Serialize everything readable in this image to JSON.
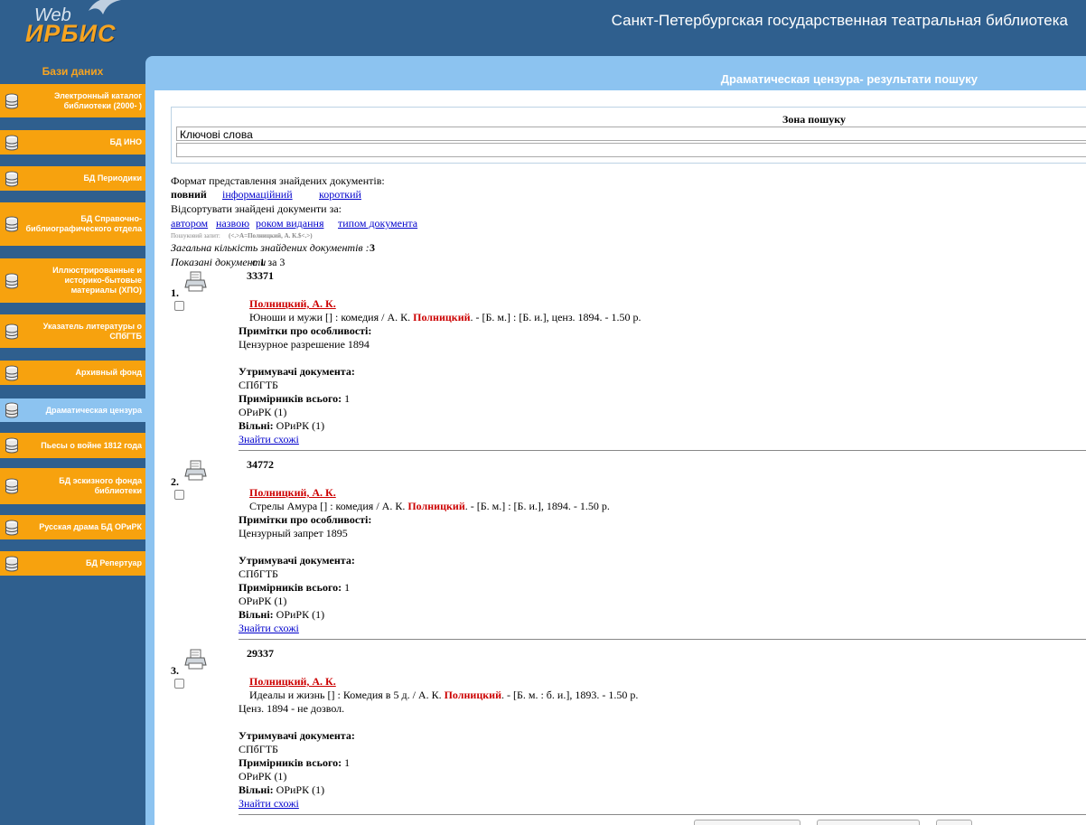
{
  "header": {
    "logo_web": "Web",
    "logo_irbis": "ИРБИС",
    "site_title": "Санкт-Петербургская государственная театральная библиотека"
  },
  "sidebar": {
    "title": "Бази даних",
    "items": [
      {
        "label": "Электронный каталог библиотеки (2000- )",
        "active": false
      },
      {
        "label": "БД ИНО",
        "active": false
      },
      {
        "label": "БД Периодики",
        "active": false
      },
      {
        "label": "БД Справочно-библиографического отдела",
        "active": false
      },
      {
        "label": "Иллюстрированные и историко-бытовые материалы (ХПО)",
        "active": false
      },
      {
        "label": "Указатель литературы о СПбГТБ",
        "active": false
      },
      {
        "label": "Архивный фонд",
        "active": false
      },
      {
        "label": "Драматическая цензура",
        "active": true
      },
      {
        "label": "Пьесы о войне 1812 года",
        "active": false
      },
      {
        "label": "БД эскизного фонда библиотеки",
        "active": false
      },
      {
        "label": "Русская драма БД ОРиРК",
        "active": false
      },
      {
        "label": "БД Репертуар",
        "active": false
      }
    ]
  },
  "panel": {
    "title": "Драматическая цензура- результати пошуку"
  },
  "search": {
    "zone_label": "Зона пошуку",
    "field_value": "Ключові слова",
    "query_value": ""
  },
  "format": {
    "label": "Формат представлення знайдених документів:",
    "full": "повний",
    "info": "інформаційний",
    "short": "короткий"
  },
  "sort": {
    "label": "Відсортувати знайдені документи за:",
    "by_author": "автором",
    "by_title": "назвою",
    "by_year": "роком видання",
    "by_type": "типом документа"
  },
  "query_line": {
    "label": "Пошуковий запит:",
    "value": "(<.>A=Полницкий, А. К.$<.>)"
  },
  "total": {
    "label": "Загальна кількість знайдених документів :",
    "count": "3"
  },
  "shown": {
    "label": "Показані документи",
    "range": "с 1 за 3"
  },
  "labels": {
    "notes": "Примітки про особливості:",
    "holders": "Утримувачі документа:",
    "copies_total": "Примірників всього:",
    "free": "Вільні:",
    "find_similar": "Знайти схожі"
  },
  "results": [
    {
      "num": "1.",
      "id": "33371",
      "author": "Полницкий, А. К.",
      "desc_before": "Юноши и мужи [] : комедия / А. К.",
      "desc_hl": "Полницкий",
      "desc_after": ". - [Б. м.] : [Б. и.], ценз. 1894. - 1.50 р.",
      "notes": "Цензурное разрешение 1894",
      "holder": "СПбГТБ",
      "copies": "1",
      "dept": "ОРиРК (1)",
      "free": "ОРиРК (1)"
    },
    {
      "num": "2.",
      "id": "34772",
      "author": "Полницкий, А. К.",
      "desc_before": "Стрелы Амура [] : комедия / А. К.",
      "desc_hl": "Полницкий",
      "desc_after": ". - [Б. м.] : [Б. и.], 1894. - 1.50 р.",
      "notes": "Цензурный запрет 1895",
      "holder": "СПбГТБ",
      "copies": "1",
      "dept": "ОРиРК (1)",
      "free": "ОРиРК (1)"
    },
    {
      "num": "3.",
      "id": "29337",
      "author": "Полницкий, А. К.",
      "desc_before": "Идеалы и жизнь [] : Комедия в 5 д. / А. К.",
      "desc_hl": "Полницкий",
      "desc_after": ". - [Б. м. : б. и.], 1893. - 1.50 р.",
      "notes": "Ценз. 1894 - не дозвол.",
      "holder": "СПбГТБ",
      "copies": "1",
      "dept": "ОРиРК (1)",
      "free": "ОРиРК (1)"
    }
  ],
  "colors": {
    "background": "#2f5f8e",
    "accent_orange": "#f7a20e",
    "panel_blue": "#8cc3f0",
    "highlight_red": "#cc0000",
    "link_blue": "#0000cc"
  }
}
